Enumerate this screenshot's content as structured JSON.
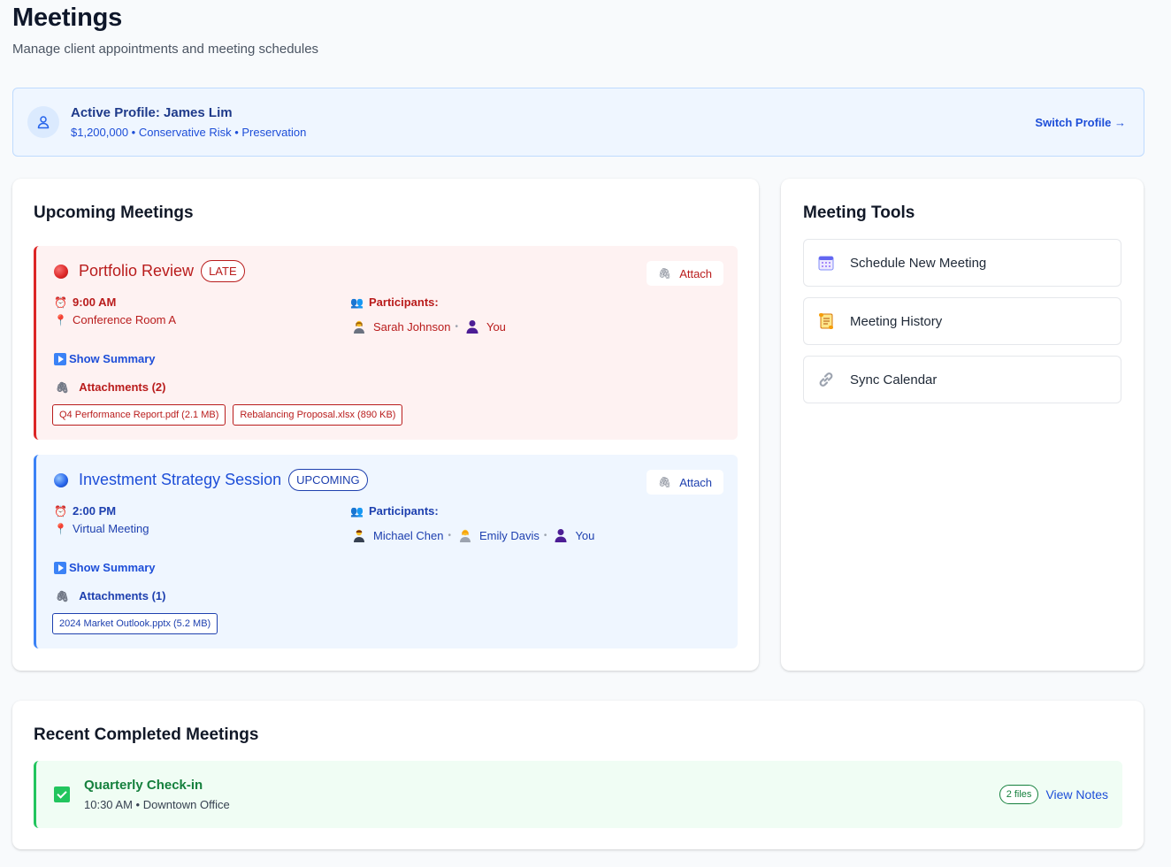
{
  "header": {
    "title": "Meetings",
    "subtitle": "Manage client appointments and meeting schedules"
  },
  "profile": {
    "name": "Active Profile: James Lim",
    "details": "$1,200,000 • Conservative Risk • Preservation",
    "switch_label": "Switch Profile →"
  },
  "upcoming": {
    "title": "Upcoming Meetings",
    "meetings": [
      {
        "title": "Portfolio Review",
        "status": "LATE",
        "attach_label": "Attach",
        "time": "9:00 AM",
        "location": "Conference Room A",
        "participants_label": "Participants:",
        "participants": [
          "Sarah Johnson",
          "You"
        ],
        "summary_label": "Show Summary",
        "attachments_label": "Attachments (2)",
        "files": [
          "Q4 Performance Report.pdf (2.1 MB)",
          "Rebalancing Proposal.xlsx (890 KB)"
        ]
      },
      {
        "title": "Investment Strategy Session",
        "status": "UPCOMING",
        "attach_label": "Attach",
        "time": "2:00 PM",
        "location": "Virtual Meeting",
        "participants_label": "Participants:",
        "participants": [
          "Michael Chen",
          "Emily Davis",
          "You"
        ],
        "summary_label": "Show Summary",
        "attachments_label": "Attachments (1)",
        "files": [
          "2024 Market Outlook.pptx (5.2 MB)"
        ]
      }
    ]
  },
  "tools": {
    "title": "Meeting Tools",
    "items": [
      {
        "label": "Schedule New Meeting",
        "icon": "calendar-icon"
      },
      {
        "label": "Meeting History",
        "icon": "scroll-icon"
      },
      {
        "label": "Sync Calendar",
        "icon": "link-icon"
      }
    ]
  },
  "completed": {
    "title": "Recent Completed Meetings",
    "items": [
      {
        "title": "Quarterly Check-in",
        "subtitle": "10:30 AM • Downtown Office",
        "files_badge": "2 files",
        "view_label": "View Notes"
      }
    ]
  },
  "colors": {
    "late": "#dc2626",
    "upcoming": "#3b82f6",
    "completed": "#22c55e",
    "link": "#1d4ed8"
  }
}
